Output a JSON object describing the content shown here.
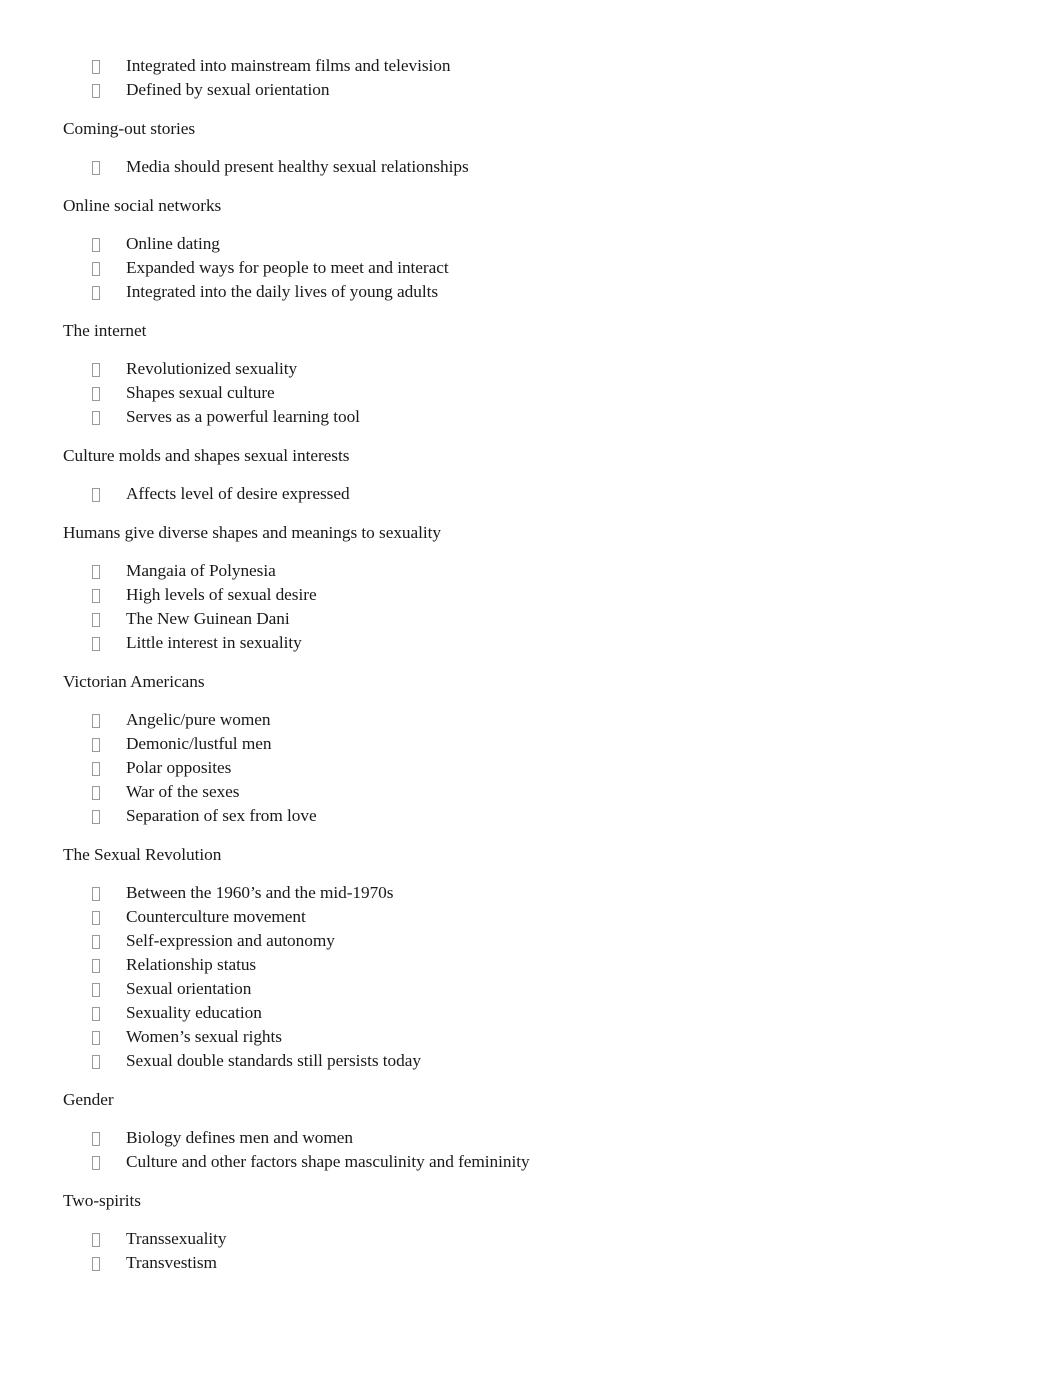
{
  "document": {
    "page_background": "#ffffff",
    "text_color": "#1a1a1a",
    "bullet_marker_glyph": "missing-glyph-box",
    "blocks": [
      {
        "type": "bullets",
        "name": "orphan-bullet-group",
        "items": [
          "Integrated into mainstream films and television",
          "Defined by sexual orientation"
        ]
      },
      {
        "type": "heading",
        "name": "heading-coming-out-stories",
        "text": "Coming-out stories"
      },
      {
        "type": "bullets",
        "name": "bullets-coming-out-stories",
        "items": [
          "Media should present healthy sexual relationships"
        ]
      },
      {
        "type": "heading",
        "name": "heading-online-social-networks",
        "text": "Online social networks"
      },
      {
        "type": "bullets",
        "name": "bullets-online-social-networks",
        "items": [
          "Online dating",
          "Expanded ways for people to meet and interact",
          "Integrated into the daily lives of young adults"
        ]
      },
      {
        "type": "heading",
        "name": "heading-the-internet",
        "text": "The internet"
      },
      {
        "type": "bullets",
        "name": "bullets-the-internet",
        "items": [
          "Revolutionized sexuality",
          "Shapes sexual culture",
          "Serves as a powerful learning tool"
        ]
      },
      {
        "type": "heading",
        "name": "heading-culture-molds",
        "text": "Culture molds and shapes sexual interests"
      },
      {
        "type": "bullets",
        "name": "bullets-culture-molds",
        "items": [
          "Affects level of desire expressed"
        ]
      },
      {
        "type": "heading",
        "name": "heading-humans-give-diverse-shapes",
        "text": "Humans give diverse shapes and meanings to sexuality"
      },
      {
        "type": "bullets",
        "name": "bullets-humans-give-diverse-shapes",
        "items": [
          "Mangaia of Polynesia",
          "High levels of sexual desire",
          "The New Guinean Dani",
          "Little interest in sexuality"
        ]
      },
      {
        "type": "heading",
        "name": "heading-victorian-americans",
        "text": "Victorian Americans"
      },
      {
        "type": "bullets",
        "name": "bullets-victorian-americans",
        "items": [
          "Angelic/pure women",
          "Demonic/lustful men",
          "Polar opposites",
          "War of the sexes",
          "Separation of sex from love"
        ]
      },
      {
        "type": "heading",
        "name": "heading-the-sexual-revolution",
        "text": "The Sexual Revolution"
      },
      {
        "type": "bullets",
        "name": "bullets-the-sexual-revolution",
        "items": [
          "Between the 1960’s and the mid-1970s",
          "Counterculture movement",
          "Self-expression and autonomy",
          "Relationship status",
          "Sexual orientation",
          "Sexuality education",
          "Women’s sexual rights",
          "Sexual double standards still persists today"
        ]
      },
      {
        "type": "heading",
        "name": "heading-gender",
        "text": "Gender"
      },
      {
        "type": "bullets",
        "name": "bullets-gender",
        "items": [
          "Biology defines men and women",
          "Culture and other factors shape masculinity and femininity"
        ]
      },
      {
        "type": "heading",
        "name": "heading-two-spirits",
        "text": "Two-spirits"
      },
      {
        "type": "bullets",
        "name": "bullets-two-spirits",
        "items": [
          "Transsexuality",
          "Transvestism"
        ]
      }
    ]
  }
}
